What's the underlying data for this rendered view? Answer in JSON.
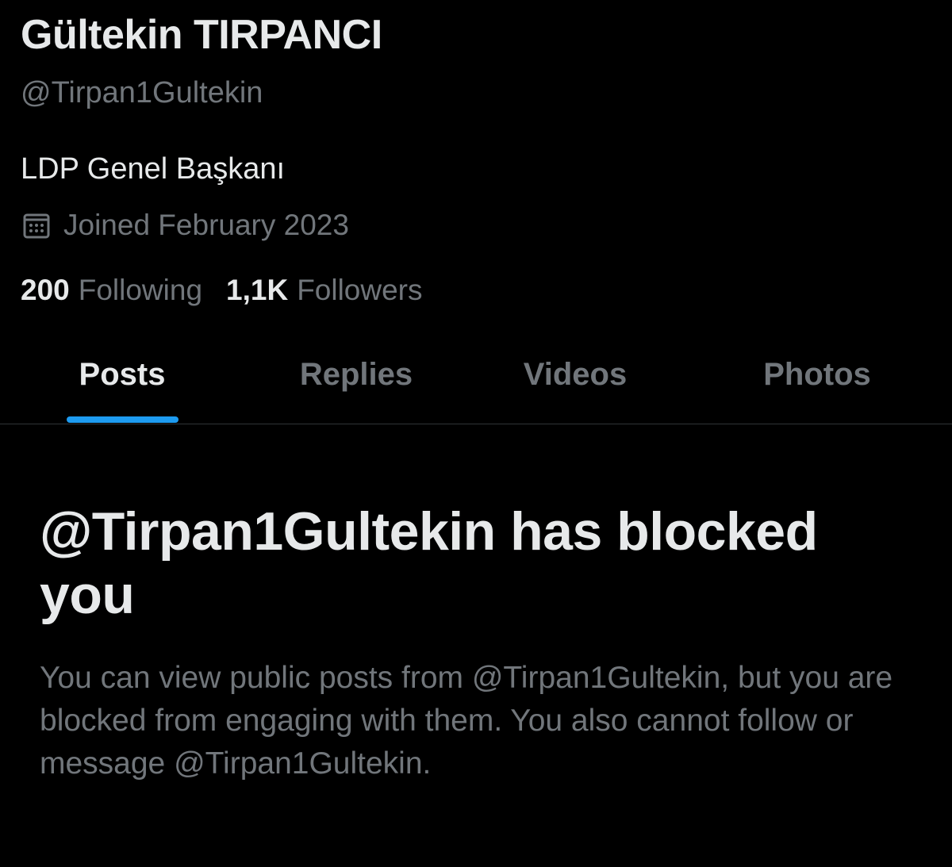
{
  "profile": {
    "display_name": "Gültekin TIRPANCI",
    "handle": "@Tirpan1Gultekin",
    "bio": "LDP Genel Başkanı",
    "joined": "Joined February 2023",
    "joined_icon": "calendar-icon",
    "following_count": "200",
    "following_label": "Following",
    "followers_count": "1,1K",
    "followers_label": "Followers"
  },
  "tabs": [
    {
      "label": "Posts",
      "active": true
    },
    {
      "label": "Replies",
      "active": false
    },
    {
      "label": "Videos",
      "active": false
    },
    {
      "label": "Photos",
      "active": false
    }
  ],
  "blocked": {
    "title": "@Tirpan1Gultekin has blocked you",
    "message": "You can view public posts from @Tirpan1Gultekin, but you are blocked from engaging with them. You also cannot follow or message @Tirpan1Gultekin."
  },
  "colors": {
    "background": "#000000",
    "primary_text": "#e7e9ea",
    "secondary_text": "#71767b",
    "accent": "#1d9bf0",
    "divider": "#2f3336"
  }
}
